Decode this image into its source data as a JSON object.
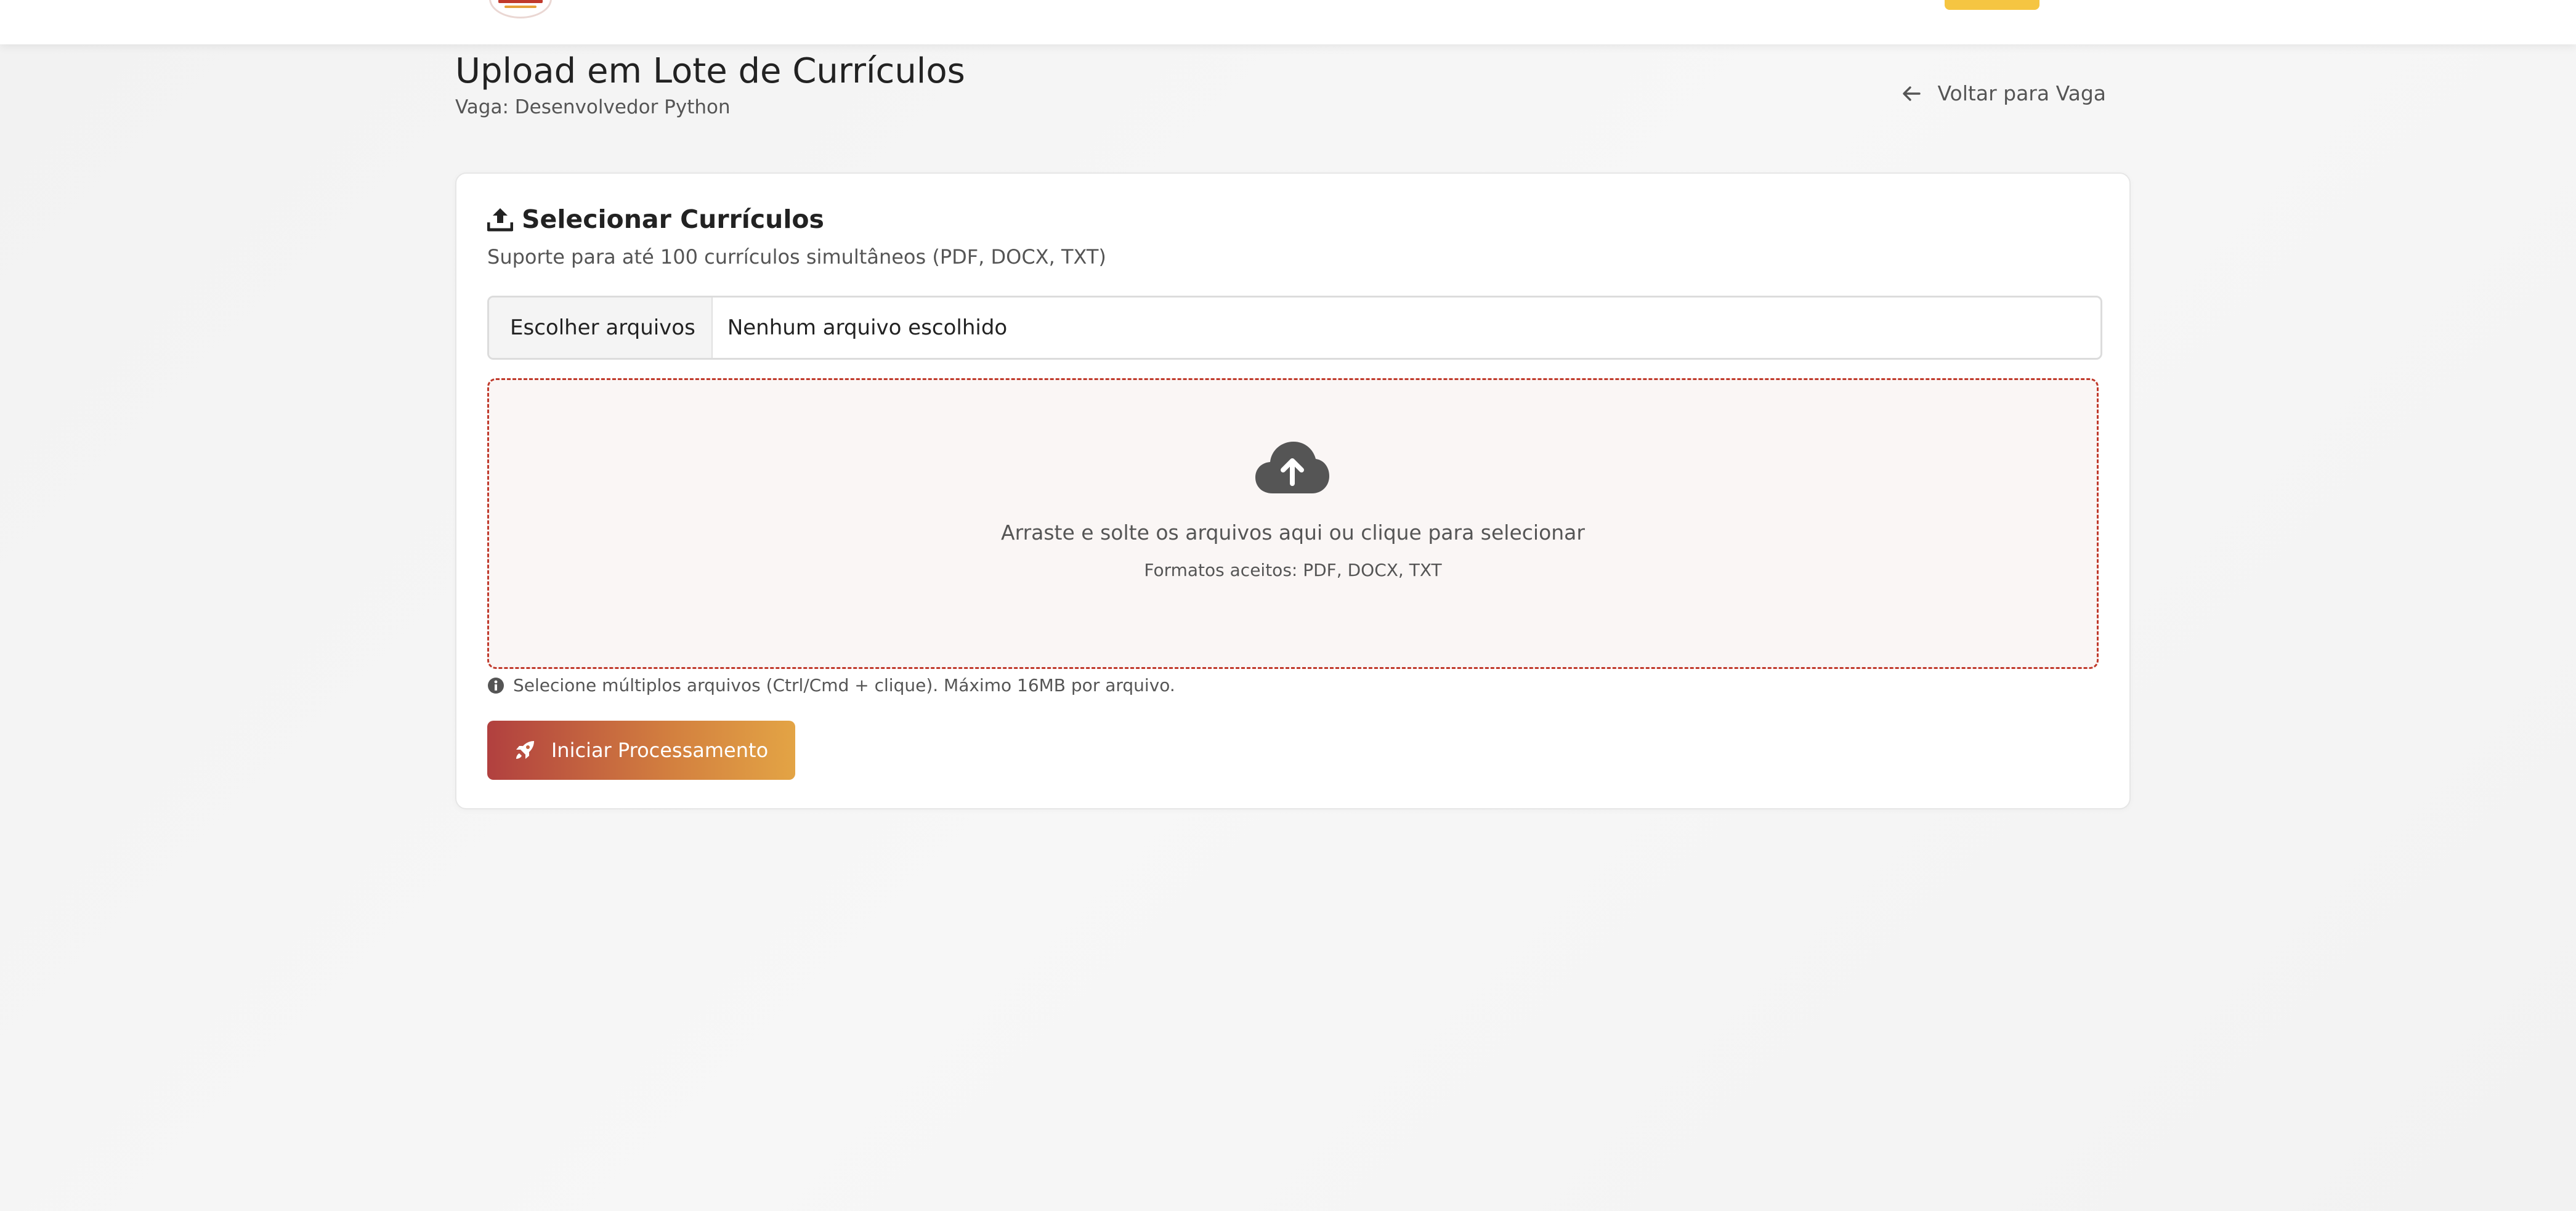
{
  "header": {
    "title": "Upload em Lote de Currículos",
    "subtitle": "Vaga: Desenvolvedor Python",
    "back_link": "Voltar para Vaga"
  },
  "card": {
    "title": "Selecionar Currículos",
    "description": "Suporte para até 100 currículos simultâneos (PDF, DOCX, TXT)",
    "file_input": {
      "button_label": "Escolher arquivos",
      "status": "Nenhum arquivo escolhido"
    },
    "drop_zone": {
      "icon": "cloud-upload-icon",
      "text": "Arraste e solte os arquivos aqui ou clique para selecionar",
      "formats": "Formatos aceitos: PDF, DOCX, TXT"
    },
    "help": "Selecione múltiplos arquivos (Ctrl/Cmd + clique). Máximo 16MB por arquivo.",
    "submit_label": "Iniciar Processamento"
  },
  "icons": {
    "back": "arrow-left-icon",
    "upload": "upload-icon",
    "info": "info-circle-icon",
    "rocket": "rocket-icon"
  },
  "colors": {
    "accent": "#c0392b",
    "accent_gradient_end": "#e3a445",
    "drop_zone_bg": "#faf6f5",
    "nav_cta": "#f5c542"
  }
}
